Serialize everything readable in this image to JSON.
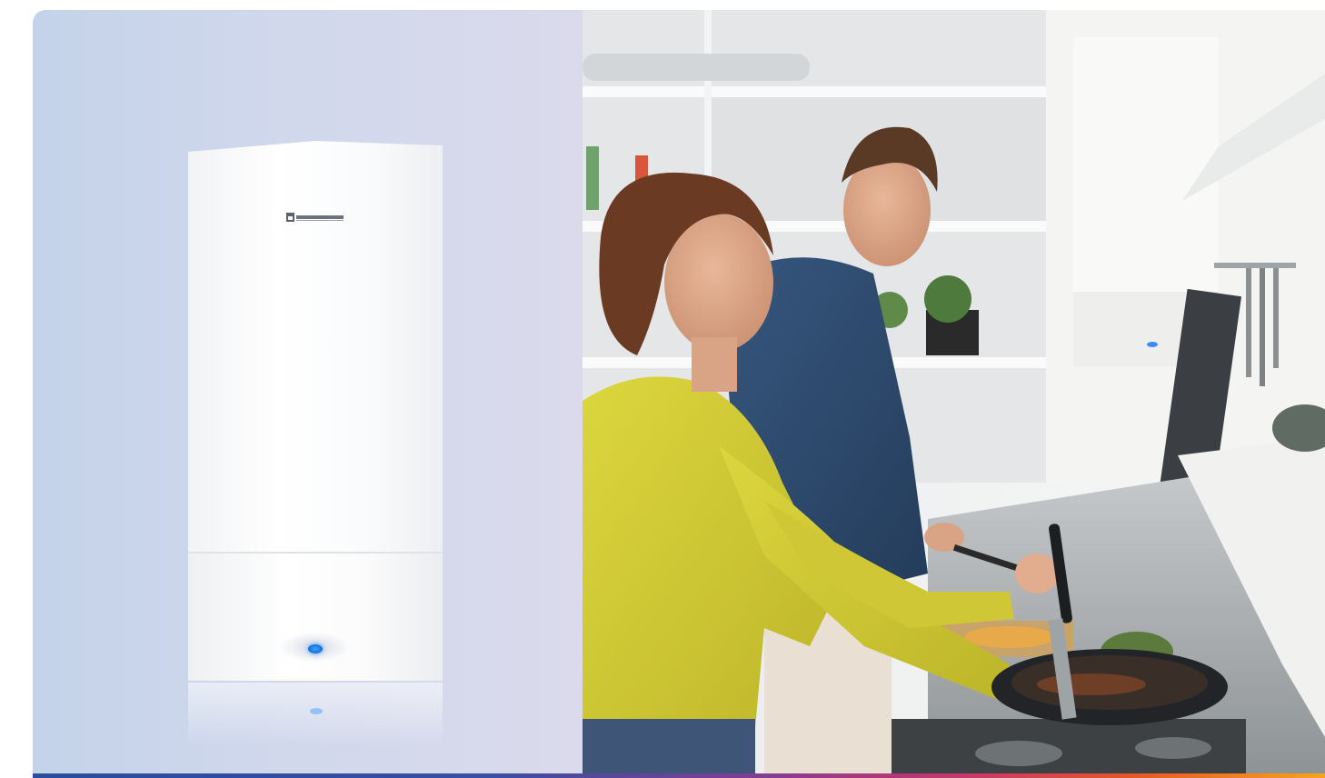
{
  "product_panel": {
    "background_start": "#c4d3ea",
    "background_end": "#dadaec",
    "boiler": {
      "body_color": "#ffffff",
      "indicator_color": "#1777e0"
    }
  },
  "photo": {
    "scene": "kitchen-couple-cooking",
    "top_color": "#f3f4f4",
    "accent_shirt_color": "#d6d23a",
    "accent_sweater_color": "#2e4a6e"
  },
  "accent_bar": {
    "colors": [
      "#2a4d9c",
      "#7a3f96",
      "#c8366a",
      "#e9542a",
      "#f4a51b"
    ]
  }
}
